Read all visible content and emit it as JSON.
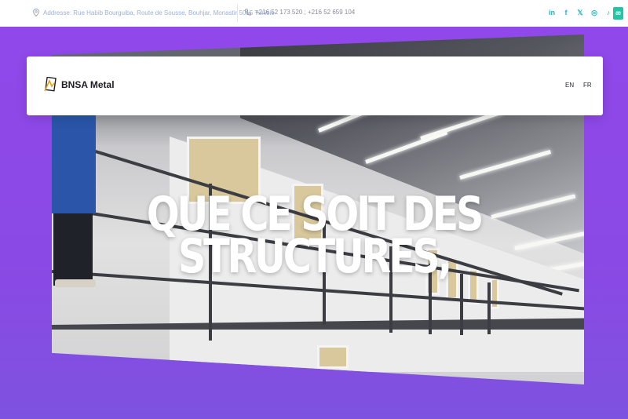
{
  "topbar": {
    "address": "Addresse: Rue Habib Bourguiba, Route de Sousse, Bouhjar, Monastir 5015 Tunisie",
    "phone": "+216 52 173 520 ; +216 52 659 104",
    "social_icons": [
      "linkedin-icon",
      "facebook-icon",
      "x-icon",
      "instagram-icon",
      "tiktok-icon"
    ],
    "badge_text": "æ"
  },
  "header": {
    "brand": "BNSA Metal",
    "lang_en": "EN",
    "lang_fr": "FR"
  },
  "hero": {
    "headline_line1": "QUE CE SOIT DES",
    "headline_line2": "STRUCTURES,"
  },
  "colors": {
    "accent": "#21b6c2",
    "hero_purple": "#8a49e4",
    "badge_green": "#20c7a6"
  }
}
